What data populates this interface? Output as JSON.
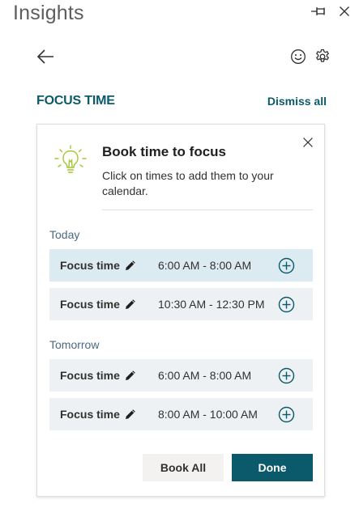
{
  "app": {
    "title": "Insights"
  },
  "section": {
    "title": "FOCUS TIME",
    "dismiss_all_label": "Dismiss all"
  },
  "card": {
    "title": "Book time to focus",
    "description": "Click on times to add them to your calendar."
  },
  "days": [
    {
      "label": "Today",
      "slots": [
        {
          "label": "Focus time",
          "time": "6:00 AM - 8:00 AM",
          "selected": true
        },
        {
          "label": "Focus time",
          "time": "10:30 AM - 12:30 PM",
          "selected": false
        }
      ]
    },
    {
      "label": "Tomorrow",
      "slots": [
        {
          "label": "Focus time",
          "time": "6:00 AM - 8:00 AM",
          "selected": false
        },
        {
          "label": "Focus time",
          "time": "8:00 AM - 10:00 AM",
          "selected": false
        }
      ]
    }
  ],
  "actions": {
    "book_all_label": "Book All",
    "done_label": "Done"
  },
  "icons": {
    "pin": "pin-icon",
    "close": "close-icon",
    "back": "back-arrow-icon",
    "feedback": "smiley-icon",
    "settings": "gear-icon",
    "lightbulb": "lightbulb-icon",
    "edit": "pencil-icon",
    "add": "add-circle-icon"
  },
  "colors": {
    "accent": "#0b5a6b",
    "slot_background": "#edf1f3",
    "slot_selected_background": "#dcebf1",
    "day_label": "#4b6a82",
    "lightbulb": "#a4c639"
  }
}
